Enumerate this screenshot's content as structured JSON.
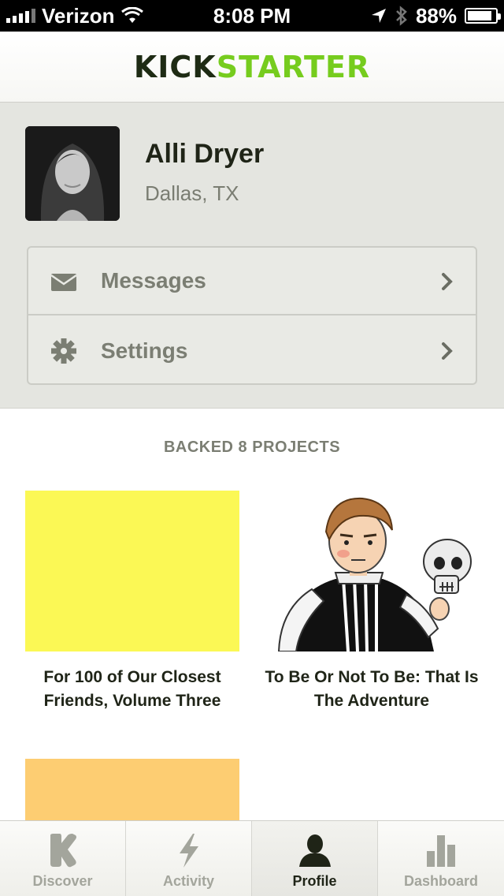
{
  "status_bar": {
    "carrier": "Verizon",
    "time": "8:08 PM",
    "battery": "88%",
    "battery_level": 0.88
  },
  "header": {
    "logo_part1": "KICK",
    "logo_part2": "STARTER",
    "logo_colors": {
      "kick": "#1e2b14",
      "starter": "#76cc1e"
    }
  },
  "profile": {
    "name": "Alli Dryer",
    "location": "Dallas, TX"
  },
  "menu": {
    "items": [
      {
        "label": "Messages",
        "icon": "envelope-icon"
      },
      {
        "label": "Settings",
        "icon": "gear-icon"
      }
    ]
  },
  "backed": {
    "title": "BACKED 8 PROJECTS",
    "projects": [
      {
        "title": "For 100 of Our Closest Friends, Volume Three",
        "thumb_color": "#fbf855"
      },
      {
        "title": "To Be Or Not To Be: That Is The Adventure",
        "thumb": "illustration-hamlet-skull"
      },
      {
        "title": "",
        "thumb_color": "#fdcd72"
      }
    ]
  },
  "tabs": [
    {
      "label": "Discover",
      "icon": "kickstarter-k-icon"
    },
    {
      "label": "Activity",
      "icon": "lightning-icon"
    },
    {
      "label": "Profile",
      "icon": "person-icon",
      "active": true
    },
    {
      "label": "Dashboard",
      "icon": "bar-chart-icon"
    }
  ]
}
